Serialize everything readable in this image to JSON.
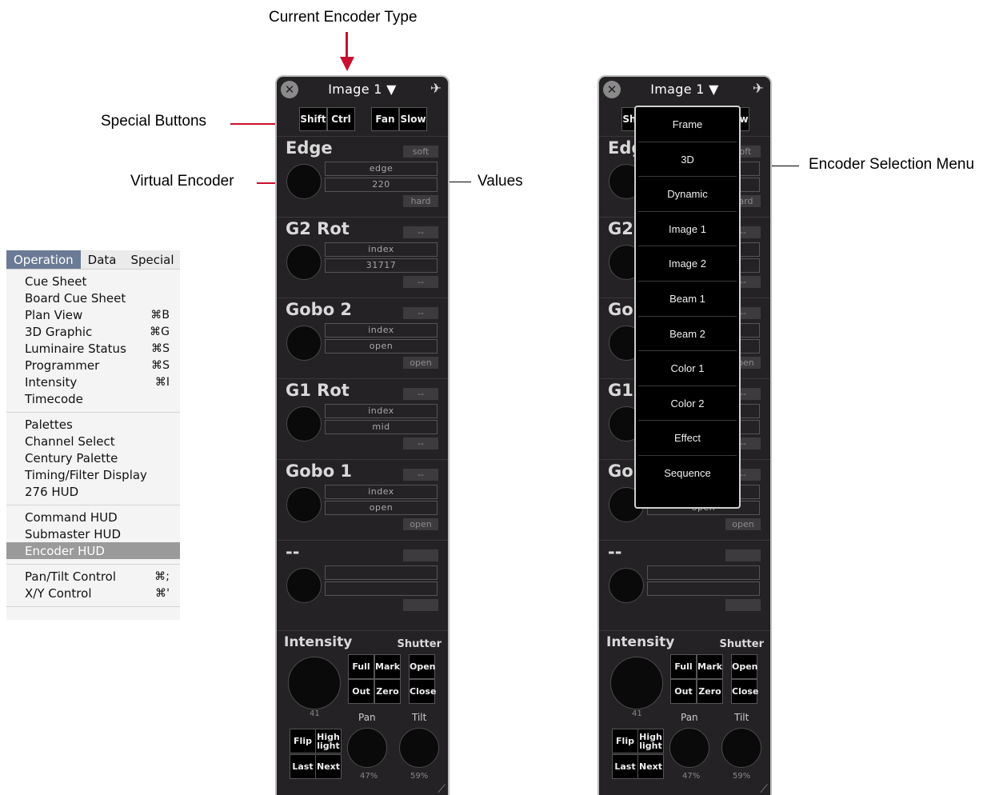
{
  "callouts": {
    "current_encoder_type": "Current Encoder Type",
    "special_buttons": "Special Buttons",
    "virtual_encoder": "Virtual Encoder",
    "values": "Values",
    "encoder_selection_menu": "Encoder Selection Menu"
  },
  "menu": {
    "bar": [
      "Operation",
      "Data",
      "Special"
    ],
    "sections": [
      [
        {
          "label": "Cue Sheet",
          "shortcut": ""
        },
        {
          "label": "Board Cue Sheet",
          "shortcut": ""
        },
        {
          "label": "Plan View",
          "shortcut": "⌘B"
        },
        {
          "label": "3D Graphic",
          "shortcut": "⌘G"
        },
        {
          "label": "Luminaire Status",
          "shortcut": "⌘S"
        },
        {
          "label": "Programmer",
          "shortcut": "⌘S"
        },
        {
          "label": "Intensity",
          "shortcut": "⌘I"
        },
        {
          "label": "Timecode",
          "shortcut": ""
        }
      ],
      [
        {
          "label": "Palettes",
          "shortcut": ""
        },
        {
          "label": "Channel Select",
          "shortcut": ""
        },
        {
          "label": "Century Palette",
          "shortcut": ""
        },
        {
          "label": "Timing/Filter Display",
          "shortcut": ""
        },
        {
          "label": "276 HUD",
          "shortcut": ""
        }
      ],
      [
        {
          "label": "Command HUD",
          "shortcut": ""
        },
        {
          "label": "Submaster HUD",
          "shortcut": ""
        },
        {
          "label": "Encoder HUD",
          "shortcut": "",
          "selected": true
        }
      ],
      [
        {
          "label": "Pan/Tilt Control",
          "shortcut": "⌘;"
        },
        {
          "label": "X/Y Control",
          "shortcut": "⌘'"
        }
      ]
    ]
  },
  "hud": {
    "encoder_type": "Image 1 ▼",
    "special": [
      "Shift",
      "Ctrl",
      "Fan",
      "Slow"
    ],
    "encoders": [
      {
        "name": "Edge",
        "top_tag": "soft",
        "v1": "edge",
        "v2": "220",
        "bottom_tag": "hard"
      },
      {
        "name": "G2 Rot",
        "top_tag": "--",
        "v1": "index",
        "v2": "31717",
        "bottom_tag": "--"
      },
      {
        "name": "Gobo 2",
        "top_tag": "--",
        "v1": "index",
        "v2": "open",
        "bottom_tag": "open"
      },
      {
        "name": "G1 Rot",
        "top_tag": "--",
        "v1": "index",
        "v2": "mid",
        "bottom_tag": "--"
      },
      {
        "name": "Gobo 1",
        "top_tag": "--",
        "v1": "index",
        "v2": "open",
        "bottom_tag": "open"
      },
      {
        "name": "--",
        "top_tag": "",
        "v1": "",
        "v2": "",
        "bottom_tag": ""
      }
    ],
    "intensity_label": "Intensity",
    "shutter_label": "Shutter",
    "buttons": {
      "full": "Full",
      "mark": "Mark",
      "out": "Out",
      "zero": "Zero",
      "open": "Open",
      "close": "Close",
      "flip": "Flip",
      "high": "High",
      "light": "light",
      "last": "Last",
      "next": "Next"
    },
    "intensity_value": "41",
    "pan_label": "Pan",
    "tilt_label": "Tilt",
    "pan_value": "47%",
    "tilt_value": "59%"
  },
  "dropdown": [
    "Frame",
    "3D",
    "Dynamic",
    "Image 1",
    "Image 2",
    "Beam 1",
    "Beam 2",
    "Color 1",
    "Color 2",
    "Effect",
    "Sequence"
  ],
  "colors": {
    "panel": "#252225",
    "accent": "#c8102e",
    "menu_active": "#6b7b95"
  }
}
